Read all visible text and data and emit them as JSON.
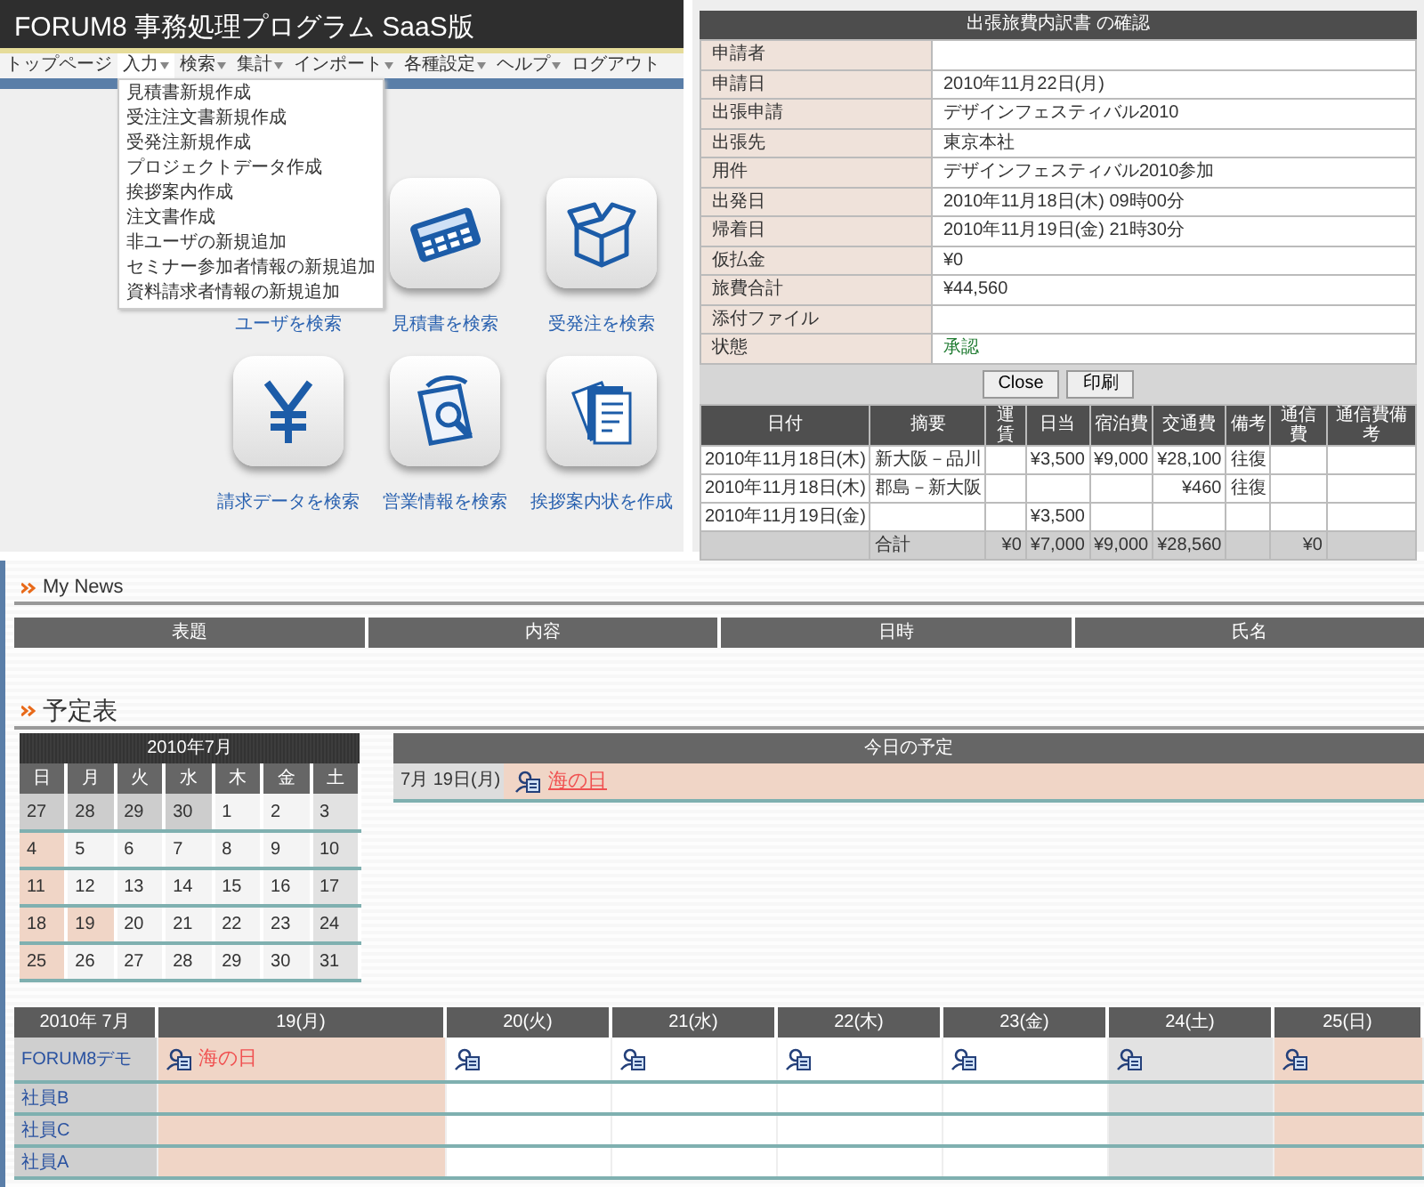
{
  "app": {
    "title": "FORUM8 事務処理プログラム SaaS版",
    "nav": [
      {
        "label": "トップページ",
        "selected": false,
        "has_menu": false
      },
      {
        "label": "入力",
        "selected": true,
        "has_menu": true
      },
      {
        "label": "検索",
        "selected": false,
        "has_menu": true
      },
      {
        "label": "集計",
        "selected": false,
        "has_menu": true
      },
      {
        "label": "インポート",
        "selected": false,
        "has_menu": true
      },
      {
        "label": "各種設定",
        "selected": false,
        "has_menu": true
      },
      {
        "label": "ヘルプ",
        "selected": false,
        "has_menu": true
      },
      {
        "label": "ログアウト",
        "selected": false,
        "has_menu": false
      }
    ],
    "menu": [
      "見積書新規作成",
      "受注注文書新規作成",
      "受発注新規作成",
      "プロジェクトデータ作成",
      "挨拶案内作成",
      "注文書作成",
      "非ユーザの新規追加",
      "セミナー参加者情報の新規追加",
      "資料請求者情報の新規追加"
    ],
    "tiles": [
      {
        "label": "ユーザを検索"
      },
      {
        "kind": "calculator",
        "label": "見積書を検索"
      },
      {
        "kind": "box",
        "label": "受発注を検索"
      },
      {
        "kind": "yen",
        "label": "請求データを検索"
      },
      {
        "kind": "magnifier",
        "label": "営業情報を検索"
      },
      {
        "kind": "documents",
        "label": "挨拶案内状を作成"
      }
    ]
  },
  "report": {
    "title": "出張旅費内訳書 の確認",
    "fields": [
      {
        "label": "申請者",
        "kind": "text"
      },
      {
        "label": "申請日",
        "value": "2010年11月22日(月)",
        "kind": "text"
      },
      {
        "label": "出張申請",
        "value": "デザインフェスティバル2010",
        "kind": "text"
      },
      {
        "label": "出張先",
        "value": "東京本社",
        "kind": "text"
      },
      {
        "label": "用件",
        "value": "デザインフェスティバル2010参加",
        "kind": "text"
      },
      {
        "label": "出発日",
        "value": "2010年11月18日(木) 09時00分",
        "kind": "text"
      },
      {
        "label": "帰着日",
        "value": "2010年11月19日(金) 21時30分",
        "kind": "text"
      },
      {
        "label": "仮払金",
        "value": "¥0",
        "kind": "text"
      },
      {
        "label": "旅費合計",
        "value": "¥44,560",
        "kind": "text"
      },
      {
        "label": "添付ファイル",
        "kind": "text"
      },
      {
        "label": "状態",
        "value": "承認",
        "kind": "status"
      }
    ],
    "buttons": [
      "Close",
      "印刷"
    ],
    "columns": [
      "日付",
      "摘要",
      "運賃",
      "日当",
      "宿泊費",
      "交通費",
      "備考",
      "通信費",
      "通信費備考"
    ],
    "rows": [
      {
        "kind": "item",
        "cells": [
          "2010年11月18日(木)",
          "新大阪－品川",
          null,
          "¥3,500",
          "¥9,000",
          "¥28,100",
          "往復",
          null,
          null
        ]
      },
      {
        "kind": "item",
        "cells": [
          "2010年11月18日(木)",
          "郡島－新大阪",
          null,
          null,
          null,
          "¥460",
          "往復",
          null,
          null
        ]
      },
      {
        "kind": "item",
        "cells": [
          "2010年11月19日(金)",
          null,
          null,
          "¥3,500",
          null,
          null,
          null,
          null,
          null
        ]
      },
      {
        "kind": "total",
        "cells": [
          null,
          "合計",
          "¥0",
          "¥7,000",
          "¥9,000",
          "¥28,560",
          null,
          "¥0",
          null
        ]
      }
    ]
  },
  "news": {
    "title": "My News",
    "columns": [
      "表題",
      "内容",
      "日時",
      "氏名"
    ]
  },
  "schedule": {
    "title": "予定表",
    "calendar": {
      "month": "2010年7月",
      "weekdays": [
        "日",
        "月",
        "火",
        "水",
        "木",
        "金",
        "土"
      ],
      "weeks": [
        [
          {
            "day": "27",
            "kind": "other"
          },
          {
            "day": "28",
            "kind": "other"
          },
          {
            "day": "29",
            "kind": "other"
          },
          {
            "day": "30",
            "kind": "other"
          },
          {
            "day": "1",
            "kind": "weekday"
          },
          {
            "day": "2",
            "kind": "weekday"
          },
          {
            "day": "3",
            "kind": "saturday"
          }
        ],
        [
          {
            "day": "4",
            "kind": "sunday"
          },
          {
            "day": "5",
            "kind": "weekday"
          },
          {
            "day": "6",
            "kind": "weekday"
          },
          {
            "day": "7",
            "kind": "weekday"
          },
          {
            "day": "8",
            "kind": "weekday"
          },
          {
            "day": "9",
            "kind": "weekday"
          },
          {
            "day": "10",
            "kind": "saturday"
          }
        ],
        [
          {
            "day": "11",
            "kind": "sunday"
          },
          {
            "day": "12",
            "kind": "weekday"
          },
          {
            "day": "13",
            "kind": "weekday"
          },
          {
            "day": "14",
            "kind": "weekday"
          },
          {
            "day": "15",
            "kind": "weekday"
          },
          {
            "day": "16",
            "kind": "weekday"
          },
          {
            "day": "17",
            "kind": "saturday"
          }
        ],
        [
          {
            "day": "18",
            "kind": "sunday"
          },
          {
            "day": "19",
            "kind": "holiday"
          },
          {
            "day": "20",
            "kind": "weekday"
          },
          {
            "day": "21",
            "kind": "weekday"
          },
          {
            "day": "22",
            "kind": "weekday"
          },
          {
            "day": "23",
            "kind": "weekday"
          },
          {
            "day": "24",
            "kind": "saturday"
          }
        ],
        [
          {
            "day": "25",
            "kind": "sunday"
          },
          {
            "day": "26",
            "kind": "weekday"
          },
          {
            "day": "27",
            "kind": "weekday"
          },
          {
            "day": "28",
            "kind": "weekday"
          },
          {
            "day": "29",
            "kind": "weekday"
          },
          {
            "day": "30",
            "kind": "weekday"
          },
          {
            "day": "31",
            "kind": "saturday"
          }
        ]
      ]
    },
    "today": {
      "title": "今日の予定",
      "rows": [
        {
          "date": "7月 19日(月)",
          "icon": true,
          "event": "海の日"
        }
      ]
    },
    "weekly": {
      "corner": "2010年 7月",
      "days": [
        {
          "label": "19(月)",
          "kind": "holiday"
        },
        {
          "label": "20(火)",
          "kind": "weekday"
        },
        {
          "label": "21(水)",
          "kind": "weekday"
        },
        {
          "label": "22(木)",
          "kind": "weekday"
        },
        {
          "label": "23(金)",
          "kind": "weekday"
        },
        {
          "label": "24(土)",
          "kind": "saturday"
        },
        {
          "label": "25(日)",
          "kind": "sunday"
        }
      ],
      "members": [
        {
          "name": "FORUM8デモ",
          "cells": [
            {
              "icon": true,
              "event": "海の日"
            },
            {
              "icon": true
            },
            {
              "icon": true
            },
            {
              "icon": true
            },
            {
              "icon": true
            },
            {
              "icon": true
            },
            {
              "icon": true
            }
          ]
        },
        {
          "name": "社員B"
        },
        {
          "name": "社員C"
        },
        {
          "name": "社員A"
        }
      ]
    }
  }
}
